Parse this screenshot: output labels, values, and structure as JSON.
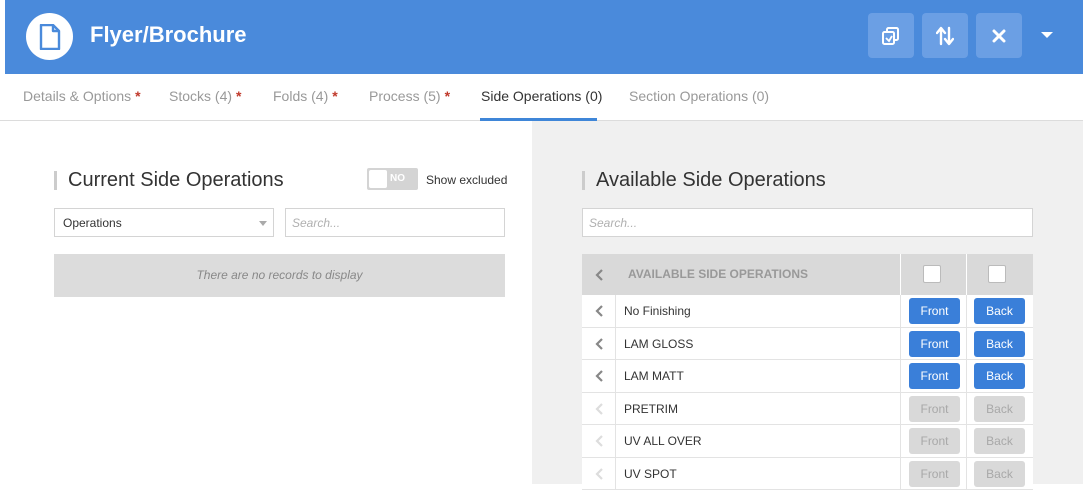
{
  "header": {
    "title": "Flyer/Brochure",
    "buttons": [
      "copy-icon",
      "sort-icon",
      "close-icon"
    ],
    "accent": "#4a8adb"
  },
  "tabs": [
    {
      "label": "Details & Options",
      "required": "*"
    },
    {
      "label": "Stocks (4)",
      "required": "*"
    },
    {
      "label": "Folds (4)",
      "required": "*"
    },
    {
      "label": "Process (5)",
      "required": "*"
    },
    {
      "label": "Side Operations (0)",
      "required": ""
    },
    {
      "label": "Section Operations (0)",
      "required": ""
    }
  ],
  "current": {
    "title": "Current Side Operations",
    "toggle_label": "NO",
    "show_excluded": "Show excluded",
    "select_value": "Operations",
    "search_placeholder": "Search...",
    "empty_text": "There are no records to display"
  },
  "available": {
    "title": "Available Side Operations",
    "search_placeholder": "Search...",
    "column_header": "AVAILABLE SIDE OPERATIONS",
    "front_label": "Front",
    "back_label": "Back",
    "rows": [
      {
        "name": "No Finishing",
        "enabled": true
      },
      {
        "name": "LAM GLOSS",
        "enabled": true
      },
      {
        "name": "LAM MATT",
        "enabled": true
      },
      {
        "name": "PRETRIM",
        "enabled": false
      },
      {
        "name": "UV ALL OVER",
        "enabled": false
      },
      {
        "name": "UV SPOT",
        "enabled": false
      }
    ]
  }
}
